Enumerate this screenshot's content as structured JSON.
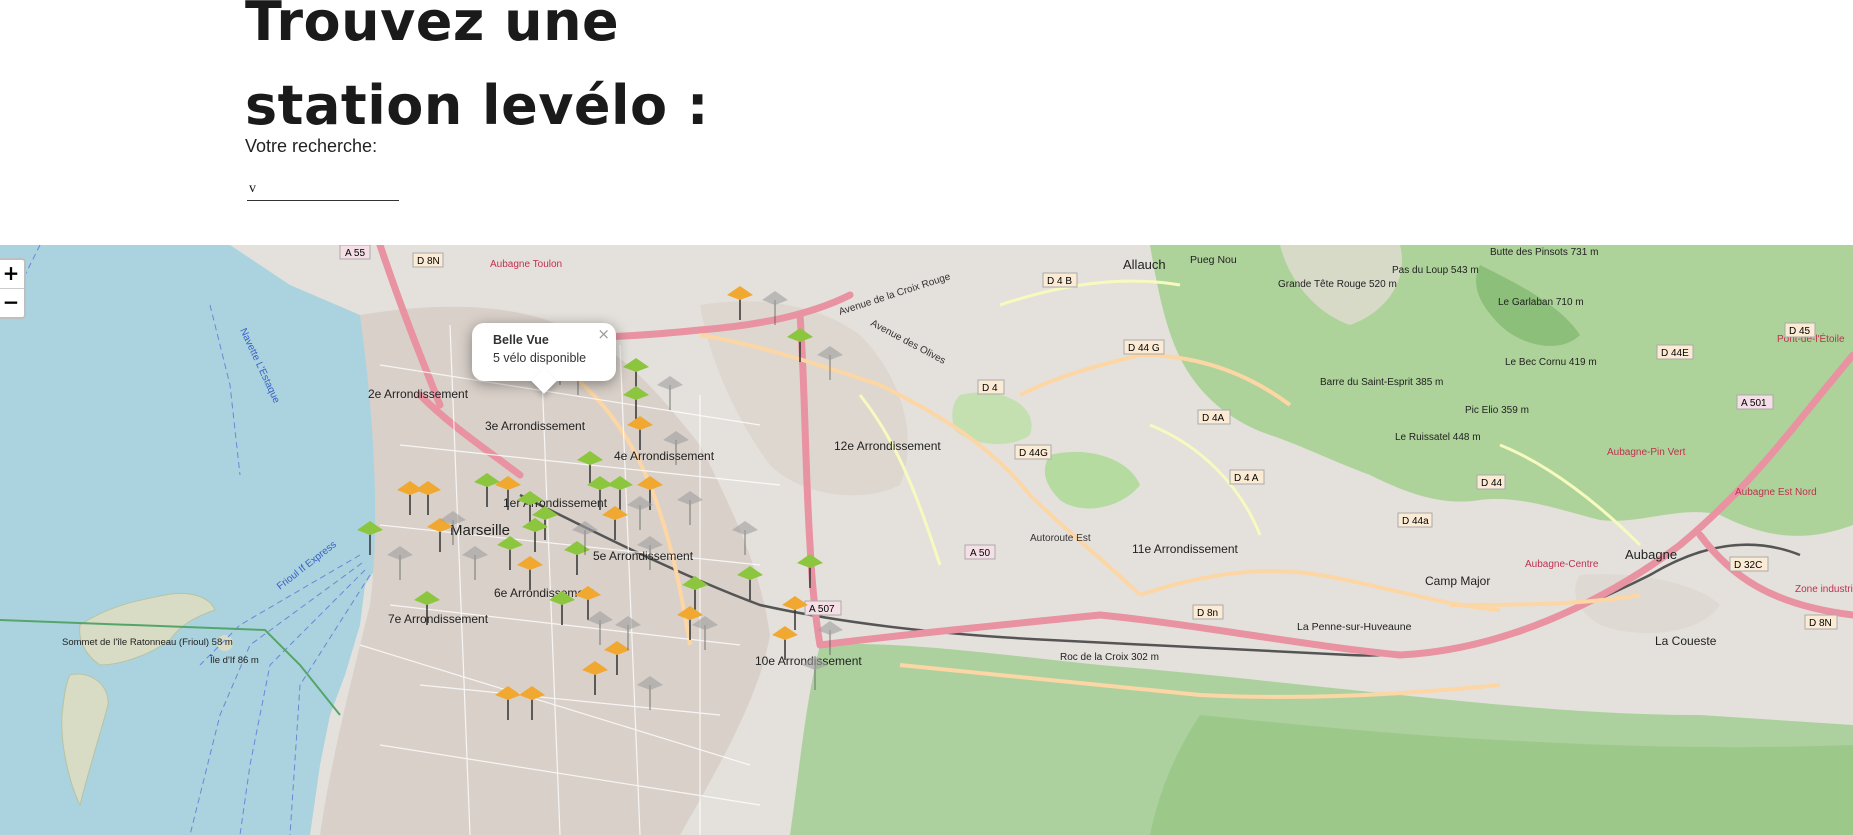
{
  "heading": {
    "line1": "Trouvez une",
    "line2": "station levélo :"
  },
  "search": {
    "label": "Votre recherche:",
    "value": "v"
  },
  "map": {
    "zoom_in": "+",
    "zoom_out": "−",
    "colors": {
      "sea": "#aad3df",
      "land": "#e6e4df",
      "park": "#c8dfb0",
      "motorway": "#e892a2",
      "primary": "#fcd6a4",
      "station_available": "#8cc63f",
      "station_partial": "#f0a830",
      "station_empty": "#9e9e9e"
    },
    "places": [
      "2e Arrondissement",
      "3e Arrondissement",
      "4e Arrondissement",
      "1er Arrondissement",
      "Marseille",
      "5e Arrondissement",
      "6e Arrondissement",
      "7e Arrondissement",
      "12e Arrondissement",
      "11e Arrondissement",
      "10e Arrondissement",
      "Allauch",
      "Aubagne",
      "Camp Major",
      "La Penne-sur-Huveaune",
      "La Coueste",
      "Pueg Nou",
      "Grande Tête Rouge 520 m",
      "Pas du Loup 543 m",
      "Butte des Pinsots 731 m",
      "Le Garlaban 710 m",
      "Barre du Saint-Esprit 385 m",
      "Le Bec Cornu 419 m",
      "Pic Elio 359 m",
      "Le Ruissatel 448 m",
      "Sommet de l'île Ratonneau (Frioul) 58 m",
      "Île d'If 86 m",
      "Roc de la Croix 302 m",
      "Aubagne Toulon",
      "Aubagne-Pin Vert",
      "Aubagne Est Nord",
      "Aubagne-Centre",
      "Zone industrielle des Paluds",
      "Pont-de-l'Étoile"
    ],
    "roads": [
      "A 55",
      "D 8N",
      "D 4 B",
      "D 44 G",
      "D 4",
      "D 4A",
      "D 44G",
      "D 4 A",
      "D 44",
      "D 44a",
      "D 44E",
      "D 45",
      "A 501",
      "D 32C",
      "D 8N",
      "A 50",
      "A 507",
      "D 8n",
      "Autoroute Est",
      "Avenue de la Croix Rouge",
      "Avenue des Olives",
      "Frioul If Express",
      "Navette L'Estaque"
    ]
  },
  "popup": {
    "title": "Belle Vue",
    "text": "5 vélo disponible",
    "close": "×"
  }
}
